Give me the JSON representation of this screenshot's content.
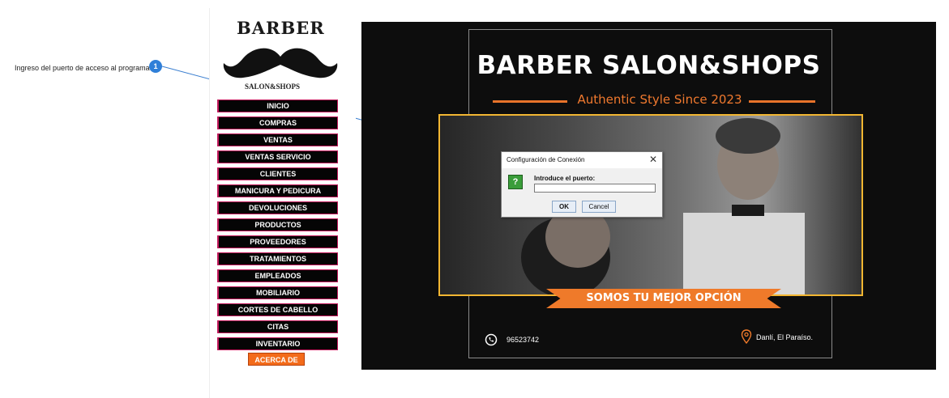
{
  "annotation": {
    "text": "Ingreso del puerto de acceso al programa",
    "badge": "1"
  },
  "logo": {
    "title": "BARBER",
    "subtitle": "SALON&SHOPS"
  },
  "menu": {
    "items": [
      {
        "label": "INICIO"
      },
      {
        "label": "COMPRAS"
      },
      {
        "label": "VENTAS"
      },
      {
        "label": "VENTAS SERVICIO"
      },
      {
        "label": "CLIENTES"
      },
      {
        "label": "MANICURA Y PEDICURA"
      },
      {
        "label": "DEVOLUCIONES"
      },
      {
        "label": "PRODUCTOS"
      },
      {
        "label": "PROVEEDORES"
      },
      {
        "label": "TRATAMIENTOS"
      },
      {
        "label": "EMPLEADOS"
      },
      {
        "label": "MOBILIARIO"
      },
      {
        "label": "CORTES DE CABELLO"
      },
      {
        "label": "CITAS"
      },
      {
        "label": "INVENTARIO"
      }
    ],
    "about_label": "ACERCA DE"
  },
  "poster": {
    "title": "BARBER SALON&SHOPS",
    "tagline": "Authentic Style Since 2023",
    "ribbon": "SOMOS TU MEJOR OPCIÓN",
    "phone": "96523742",
    "location": "Danlí, El Paraíso.",
    "phone_icon": "whatsapp-icon",
    "location_icon": "map-pin-icon"
  },
  "dialog": {
    "title": "Configuración de Conexión",
    "prompt": "Introduce el puerto:",
    "input_value": "",
    "ok_label": "OK",
    "cancel_label": "Cancel",
    "icon": "question-icon"
  },
  "colors": {
    "menu_bg": "#050505",
    "menu_border": "#c2185b",
    "about_bg": "#f36b1a",
    "poster_accent": "#ef7a2a",
    "photo_border": "#f2b632",
    "badge": "#2f7fd8"
  }
}
